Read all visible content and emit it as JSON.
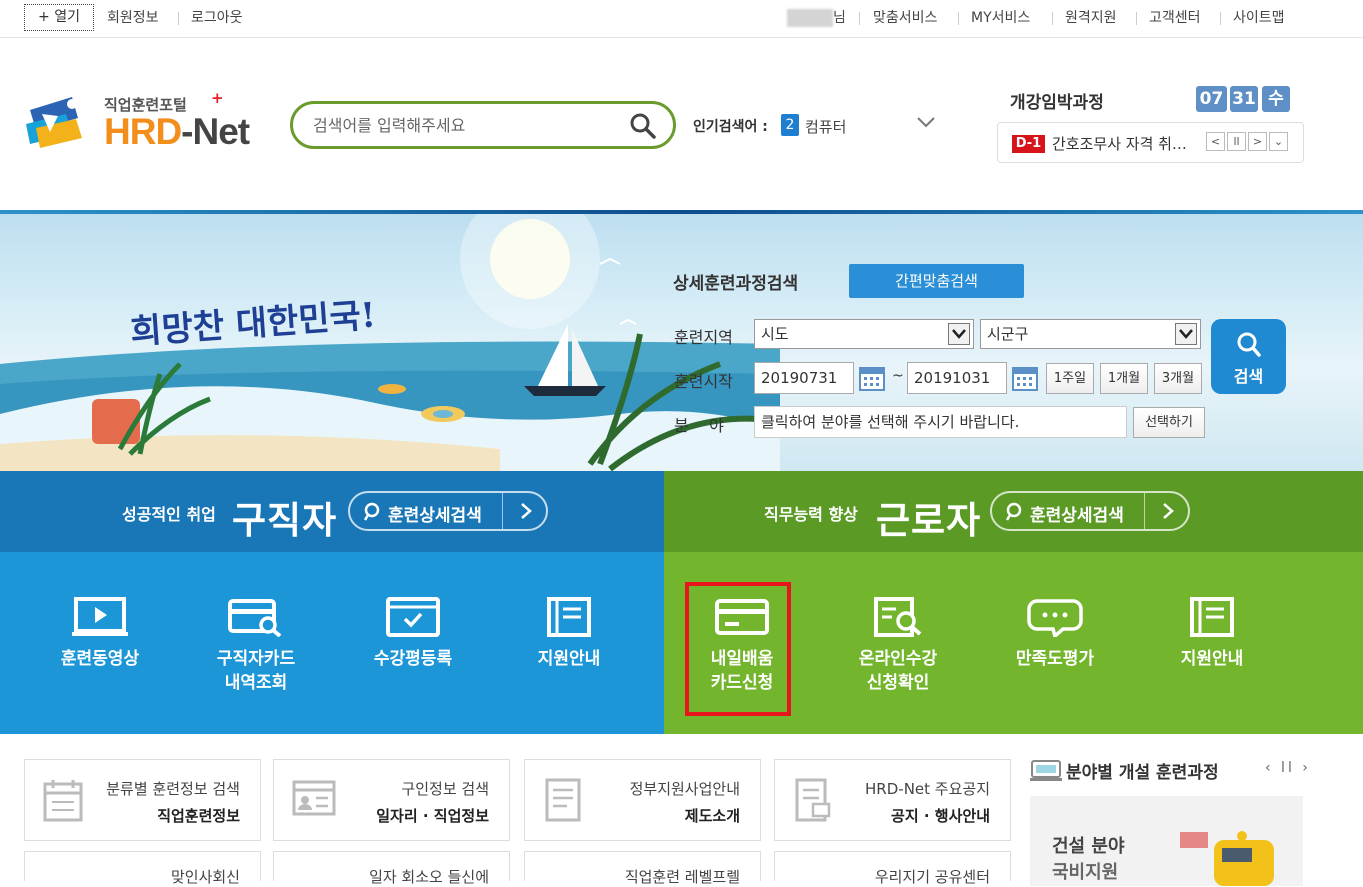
{
  "topbar": {
    "open_label": "+ 열기",
    "member_info": "회원정보",
    "logout": "로그아웃",
    "user_suffix": "님",
    "custom_service": "맞춤서비스",
    "my_service": "MY서비스",
    "remote_support": "원격지원",
    "customer_center": "고객센터",
    "sitemap": "사이트맵"
  },
  "header": {
    "logo_sub": "직업훈련포털",
    "logo_plus": "+",
    "logo_main_a": "HRD",
    "logo_main_b": "-Net",
    "search_placeholder": "검색어를 입력해주세요",
    "popular_label": "인기검색어 :",
    "popular_rank": "2",
    "popular_word": "컴퓨터",
    "imminent_title": "개강임박과정",
    "date_month": "07",
    "date_day": "31",
    "date_weekday": "수",
    "imminent_badge": "D-1",
    "imminent_text": "간호조무사 자격 취…"
  },
  "banner": {
    "slogan": "희망찬 대한민국!",
    "detail_search_title": "상세훈련과정검색",
    "quick_match_button": "간편맞춤검색",
    "region_label": "훈련지역",
    "region_sido": "시도",
    "region_sigungu": "시군구",
    "start_label": "훈련시작",
    "start_from": "20190731",
    "tilde": "~",
    "start_to": "20191031",
    "period_1w": "1주일",
    "period_1m": "1개월",
    "period_3m": "3개월",
    "field_label": "분    야",
    "field_placeholder": "클릭하여 분야를 선택해 주시기 바랍니다.",
    "field_select_button": "선택하기",
    "search_button": "검색"
  },
  "jobseeker": {
    "sub": "성공적인 취업",
    "main": "구직자",
    "search_button": "훈련상세검색",
    "items": [
      {
        "label": "훈련동영상"
      },
      {
        "label": "구직자카드\n내역조회"
      },
      {
        "label": "수강평등록"
      },
      {
        "label": "지원안내"
      }
    ]
  },
  "worker": {
    "sub": "직무능력 향상",
    "main": "근로자",
    "search_button": "훈련상세검색",
    "items": [
      {
        "label": "내일배움\n카드신청"
      },
      {
        "label": "온라인수강\n신청확인"
      },
      {
        "label": "만족도평가"
      },
      {
        "label": "지원안내"
      }
    ]
  },
  "cards": [
    {
      "sub": "분류별 훈련정보 검색",
      "title": "직업훈련정보"
    },
    {
      "sub": "구인정보 검색",
      "title": "일자리 · 직업정보"
    },
    {
      "sub": "정부지원사업안내",
      "title": "제도소개"
    },
    {
      "sub": "HRD-Net 주요공지",
      "title": "공지 · 행사안내"
    }
  ],
  "cards_row2": [
    {
      "sub": "맞인사회신"
    },
    {
      "sub": "일자 회소오 들신에"
    },
    {
      "sub": "직업훈련 레벨프렐"
    },
    {
      "sub": "우리지기 공유센터"
    }
  ],
  "side": {
    "title": "분야별 개설 훈련과정",
    "controls": "‹ ll ›",
    "line1": "건설 분야",
    "line2": "국비지원"
  }
}
